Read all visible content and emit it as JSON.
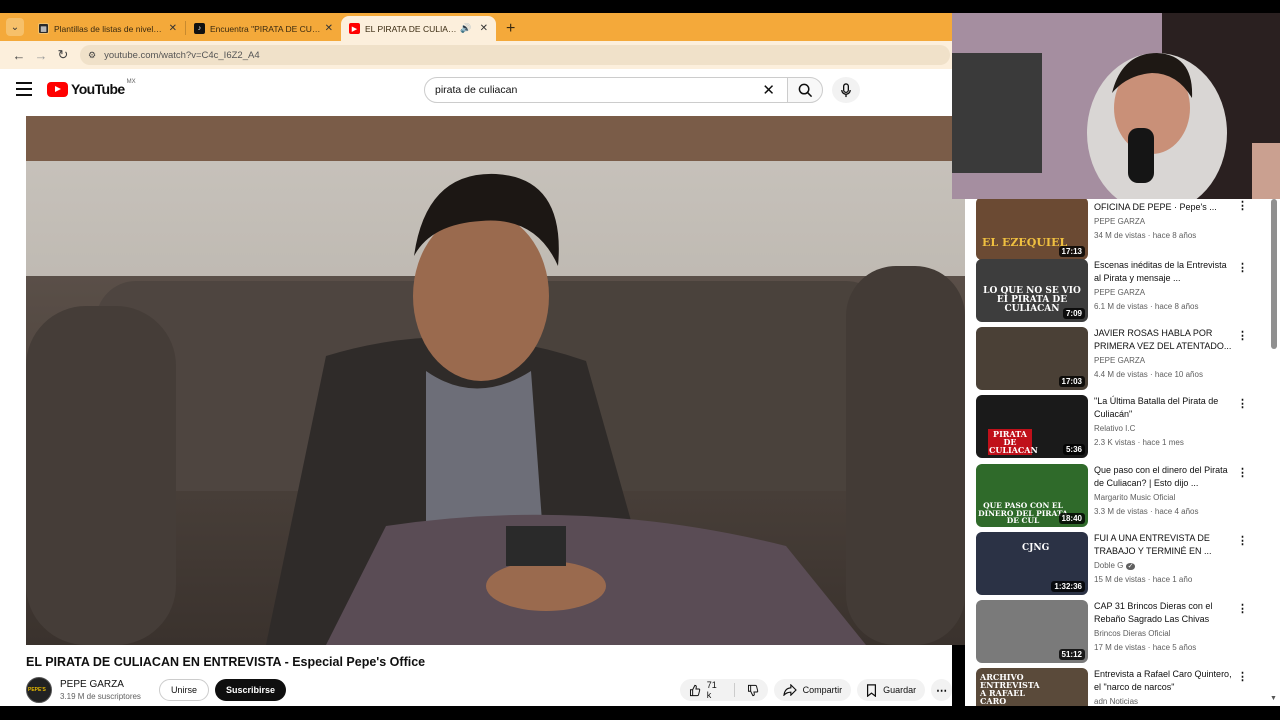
{
  "browser": {
    "tabs": [
      {
        "title": "Plantillas de listas de niveles de",
        "favicon_color": "#2a2a2a",
        "active": false
      },
      {
        "title": "Encuentra \"PIRATA DE CULIACAN",
        "favicon_color": "#111111",
        "active": false
      },
      {
        "title": "EL PIRATA DE CULIACAN EN",
        "favicon_color": "#ff0000",
        "active": true
      }
    ],
    "new_tab_label": "+",
    "url": "youtube.com/watch?v=C4c_I6Z2_A4"
  },
  "youtube": {
    "logo_text": "YouTube",
    "country_code": "MX",
    "search": {
      "query": "pirata de culiacan"
    }
  },
  "video": {
    "title": "EL PIRATA DE CULIACAN EN ENTREVISTA - Especial Pepe's Office",
    "channel": "PEPE GARZA",
    "subscribers": "3.19 M de suscriptores",
    "join_label": "Unirse",
    "subscribe_label": "Suscribirse",
    "likes": "71 k",
    "share_label": "Compartir",
    "save_label": "Guardar"
  },
  "recommendations": [
    {
      "title": "OFICINA DE PEPE · Pepe's ...",
      "channel": "PEPE GARZA",
      "meta": "34 M de vistas · hace 8 años",
      "duration": "17:13",
      "thumb_caption": "EL EZEQUIEL",
      "thumb_bg": "#6b4a33",
      "caption_color": "#f0c040"
    },
    {
      "title": "Escenas inéditas de la Entrevista al Pirata y mensaje ...",
      "channel": "PEPE GARZA",
      "meta": "6.1 M de vistas · hace 8 años",
      "duration": "7:09",
      "thumb_caption": "LO QUE NO SE VIO EI PIRATA DE CULIACAN",
      "thumb_bg": "#3d3d3d",
      "caption_color": "#ffffff"
    },
    {
      "title": "JAVIER ROSAS HABLA POR PRIMERA VEZ DEL ATENTADO...",
      "channel": "PEPE GARZA",
      "meta": "4.4 M de vistas · hace 10 años",
      "duration": "17:03",
      "thumb_caption": "",
      "thumb_bg": "#4a4036",
      "caption_color": "#ffffff"
    },
    {
      "title": "\"La Última Batalla del Pirata de Culiacán\"",
      "channel": "Relativo I.C",
      "meta": "2.3 K vistas · hace 1 mes",
      "duration": "5:36",
      "thumb_caption": "PIRATA DE CULIACAN",
      "thumb_bg": "#1a1a1a",
      "caption_color": "#ffffff"
    },
    {
      "title": "Que paso con el dinero del Pirata de Culiacan? | Esto dijo ...",
      "channel": "Margarito Music Oficial",
      "meta": "3.3 M de vistas · hace 4 años",
      "duration": "18:40",
      "thumb_caption": "QUE PASO CON EL DINERO DEL PIRATA DE CUL",
      "thumb_bg": "#2f6a2a",
      "caption_color": "#ffffff"
    },
    {
      "title": "FUI A UNA ENTREVISTA DE TRABAJO Y TERMINÉ EN ...",
      "channel": "Doble G",
      "meta": "15 M de vistas · hace 1 año",
      "duration": "1:32:36",
      "thumb_caption": "CJNG",
      "thumb_bg": "#2b3245",
      "caption_color": "#ffffff"
    },
    {
      "title": "CAP 31 Brincos Dieras con el Rebaño Sagrado   Las Chivas",
      "channel": "Brincos Dieras Oficial",
      "meta": "17 M de vistas · hace 5 años",
      "duration": "51:12",
      "thumb_caption": "",
      "thumb_bg": "#7a7a7a",
      "caption_color": "#ffffff"
    },
    {
      "title": "Entrevista a Rafael Caro Quintero, el \"narco de narcos\"",
      "channel": "adn Noticias",
      "meta": "",
      "duration": "",
      "thumb_caption": "ARCHIVO ENTREVISTA A RAFAEL CARO",
      "thumb_bg": "#5a4a3a",
      "caption_color": "#ffffff"
    }
  ]
}
